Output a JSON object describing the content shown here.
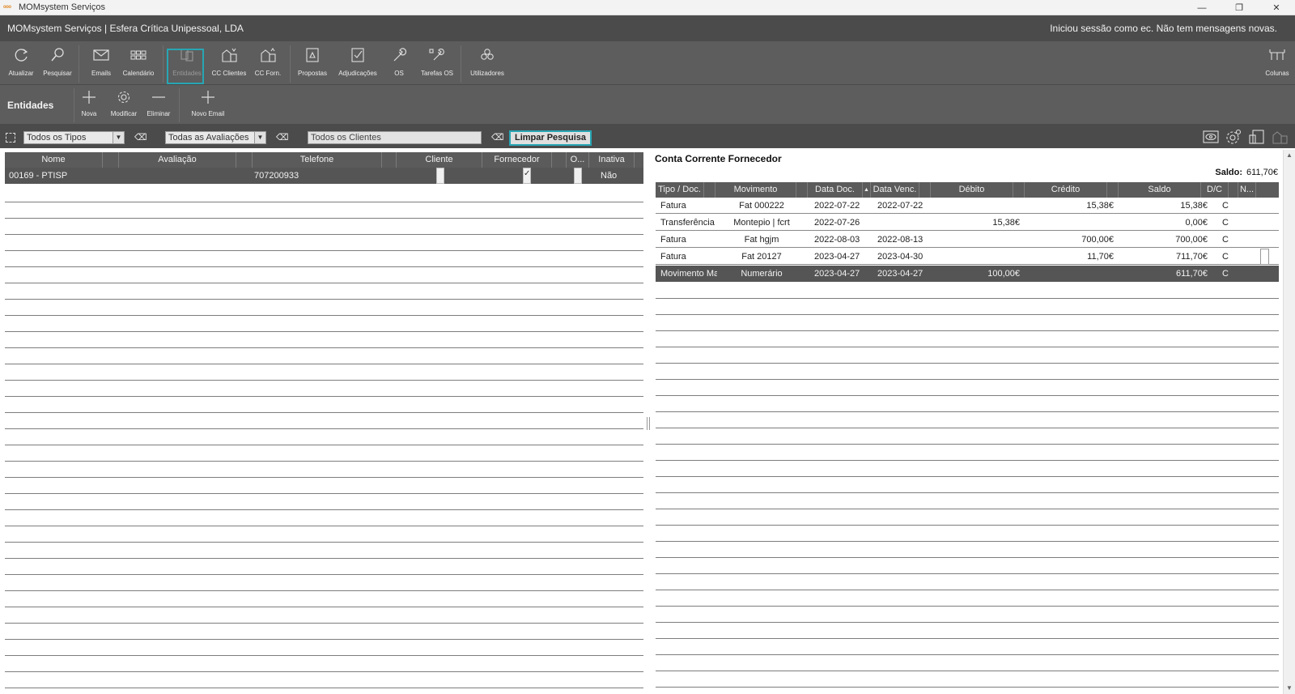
{
  "window": {
    "title": "MOMsystem Serviços",
    "controls": {
      "minimize": "—",
      "restore": "❐",
      "close": "✕"
    }
  },
  "header": {
    "company": "MOMsystem Serviços | Esfera Crítica Unipessoal, LDA",
    "session": "Iniciou sessão como ec. Não tem mensagens novas."
  },
  "toolbar": {
    "atualizar": "Atualizar",
    "pesquisar": "Pesquisar",
    "emails": "Emails",
    "calendario": "Calendário",
    "entidades": "Entidades",
    "cc_clientes": "CC Clientes",
    "cc_forn": "CC Forn.",
    "propostas": "Propostas",
    "adjudicacoes": "Adjudicações",
    "os": "OS",
    "tarefas_os": "Tarefas OS",
    "utilizadores": "Utilizadores",
    "colunas": "Colunas"
  },
  "subbar": {
    "section_title": "Entidades",
    "nova": "Nova",
    "modificar": "Modificar",
    "eliminar": "Eliminar",
    "novo_email": "Novo Email"
  },
  "filters": {
    "tipos": "Todos os Tipos",
    "avaliacoes": "Todas as Avaliações",
    "clientes": "Todos os Clientes",
    "clear": "Limpar Pesquisa"
  },
  "entities": {
    "columns": [
      "Nome",
      "Avaliação",
      "Telefone",
      "Cliente",
      "Fornecedor",
      "O...",
      "Inativa"
    ],
    "rows": [
      {
        "nome": "00169 - PTISP",
        "avaliacao": "",
        "telefone": "707200933",
        "cliente": false,
        "fornecedor": true,
        "outro": false,
        "inativa": "Não"
      }
    ]
  },
  "account": {
    "title": "Conta Corrente Fornecedor",
    "saldo_label": "Saldo:",
    "saldo_value": "611,70€",
    "columns": [
      "Tipo / Doc.",
      "Movimento",
      "Data Doc.",
      "Data Venc.",
      "Débito",
      "Crédito",
      "Saldo",
      "D/C",
      "N..."
    ],
    "rows": [
      {
        "tipo": "Fatura",
        "movimento": "Fat 000222",
        "data_doc": "2022-07-22",
        "data_venc": "2022-07-22",
        "debito": "",
        "credito": "15,38€",
        "saldo": "15,38€",
        "dc": "C",
        "doc": false
      },
      {
        "tipo": "Transferência E",
        "movimento": "Montepio | fcrt",
        "data_doc": "2022-07-26",
        "data_venc": "",
        "debito": "15,38€",
        "credito": "",
        "saldo": "0,00€",
        "dc": "C",
        "doc": false
      },
      {
        "tipo": "Fatura",
        "movimento": "Fat hgjm",
        "data_doc": "2022-08-03",
        "data_venc": "2022-08-13",
        "debito": "",
        "credito": "700,00€",
        "saldo": "700,00€",
        "dc": "C",
        "doc": false
      },
      {
        "tipo": "Fatura",
        "movimento": "Fat 20127",
        "data_doc": "2023-04-27",
        "data_venc": "2023-04-30",
        "debito": "",
        "credito": "11,70€",
        "saldo": "711,70€",
        "dc": "C",
        "doc": true
      },
      {
        "tipo": "Movimento Mar",
        "movimento": "Numerário",
        "data_doc": "2023-04-27",
        "data_venc": "2023-04-27",
        "debito": "100,00€",
        "credito": "",
        "saldo": "611,70€",
        "dc": "C",
        "doc": false
      }
    ]
  },
  "colors": {
    "accent": "#28a6b4",
    "toolbar": "#5d5d5d",
    "header": "#4b4b4b"
  }
}
